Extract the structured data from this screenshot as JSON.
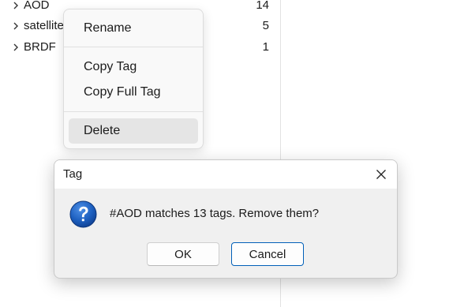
{
  "tag_tree": {
    "items": [
      {
        "name": "AOD",
        "count": "14"
      },
      {
        "name": "satellite",
        "count": "5"
      },
      {
        "name": "BRDF",
        "count": "1"
      }
    ]
  },
  "context_menu": {
    "rename": "Rename",
    "copy_tag": "Copy Tag",
    "copy_full_tag": "Copy Full Tag",
    "delete": "Delete"
  },
  "dialog": {
    "title": "Tag",
    "message": "#AOD matches 13 tags. Remove them?",
    "ok_label": "OK",
    "cancel_label": "Cancel",
    "icon": "question-icon",
    "close_icon": "close-icon"
  },
  "colors": {
    "accent": "#005fb8",
    "question_icon": "#1d5fbf"
  }
}
